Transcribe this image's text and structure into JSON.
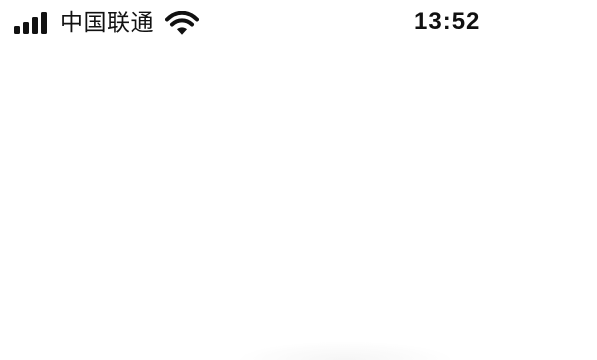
{
  "status_bar": {
    "carrier": "中国联通",
    "time": "13:52",
    "signal_icon": "cellular-signal-icon",
    "wifi_icon": "wifi-icon",
    "text_color": "#111111"
  },
  "content": {
    "background_color": "#ffffff"
  }
}
